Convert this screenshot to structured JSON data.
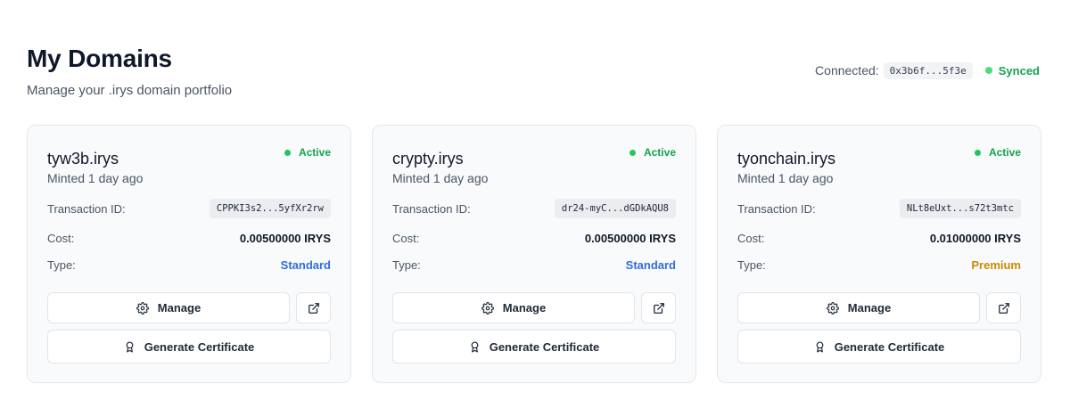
{
  "header": {
    "title": "My Domains",
    "subtitle": "Manage your .irys domain portfolio"
  },
  "connection": {
    "label": "Connected:",
    "address": "0x3b6f...5f3e",
    "sync_status": "Synced",
    "sync_color": "#16a34a"
  },
  "labels": {
    "transaction_id": "Transaction ID:",
    "cost": "Cost:",
    "type": "Type:",
    "manage": "Manage",
    "generate_certificate": "Generate Certificate"
  },
  "icons": {
    "manage": "gear-icon",
    "external": "external-link-icon",
    "certificate": "award-icon",
    "status": "status-dot"
  },
  "colors": {
    "active": "#16a34a",
    "standard": "#2563eb",
    "premium": "#ca8a04"
  },
  "domains": [
    {
      "name": "tyw3b.irys",
      "minted": "Minted 1 day ago",
      "status": "Active",
      "transaction_id": "CPPKI3s2...5yfXr2rw",
      "cost": "0.00500000 IRYS",
      "type": "Standard",
      "type_color": "#2f6fd6"
    },
    {
      "name": "crypty.irys",
      "minted": "Minted 1 day ago",
      "status": "Active",
      "transaction_id": "dr24-myC...dGDkAQU8",
      "cost": "0.00500000 IRYS",
      "type": "Standard",
      "type_color": "#2f6fd6"
    },
    {
      "name": "tyonchain.irys",
      "minted": "Minted 1 day ago",
      "status": "Active",
      "transaction_id": "NLt8eUxt...s72t3mtc",
      "cost": "0.01000000 IRYS",
      "type": "Premium",
      "type_color": "#ca8a04"
    }
  ]
}
